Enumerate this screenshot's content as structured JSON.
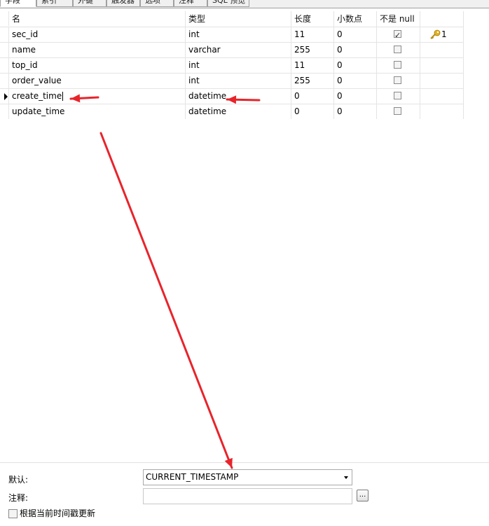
{
  "tabs": [
    "字段",
    "索引",
    "外键",
    "触发器",
    "选项",
    "注释",
    "SQL 预览"
  ],
  "columns": [
    "名",
    "类型",
    "长度",
    "小数点",
    "不是 null"
  ],
  "rows": [
    {
      "name": "sec_id",
      "type": "int",
      "length": "11",
      "decimals": "0",
      "not_null": true,
      "key": "1"
    },
    {
      "name": "name",
      "type": "varchar",
      "length": "255",
      "decimals": "0",
      "not_null": false,
      "key": ""
    },
    {
      "name": "top_id",
      "type": "int",
      "length": "11",
      "decimals": "0",
      "not_null": false,
      "key": ""
    },
    {
      "name": "order_value",
      "type": "int",
      "length": "255",
      "decimals": "0",
      "not_null": false,
      "key": ""
    },
    {
      "name": "create_time",
      "type": "datetime",
      "length": "0",
      "decimals": "0",
      "not_null": false,
      "key": ""
    },
    {
      "name": "update_time",
      "type": "datetime",
      "length": "0",
      "decimals": "0",
      "not_null": false,
      "key": ""
    }
  ],
  "selected_row": 4,
  "properties": {
    "default_label": "默认:",
    "default_value": "CURRENT_TIMESTAMP",
    "comment_label": "注释:",
    "comment_value": "",
    "ellipsis": "...",
    "update_checkbox_label": "根据当前时间戳更新",
    "update_checked": false
  },
  "colors": {
    "annotation_arrow": "#e8242b",
    "key_icon": "#e4b31c"
  }
}
